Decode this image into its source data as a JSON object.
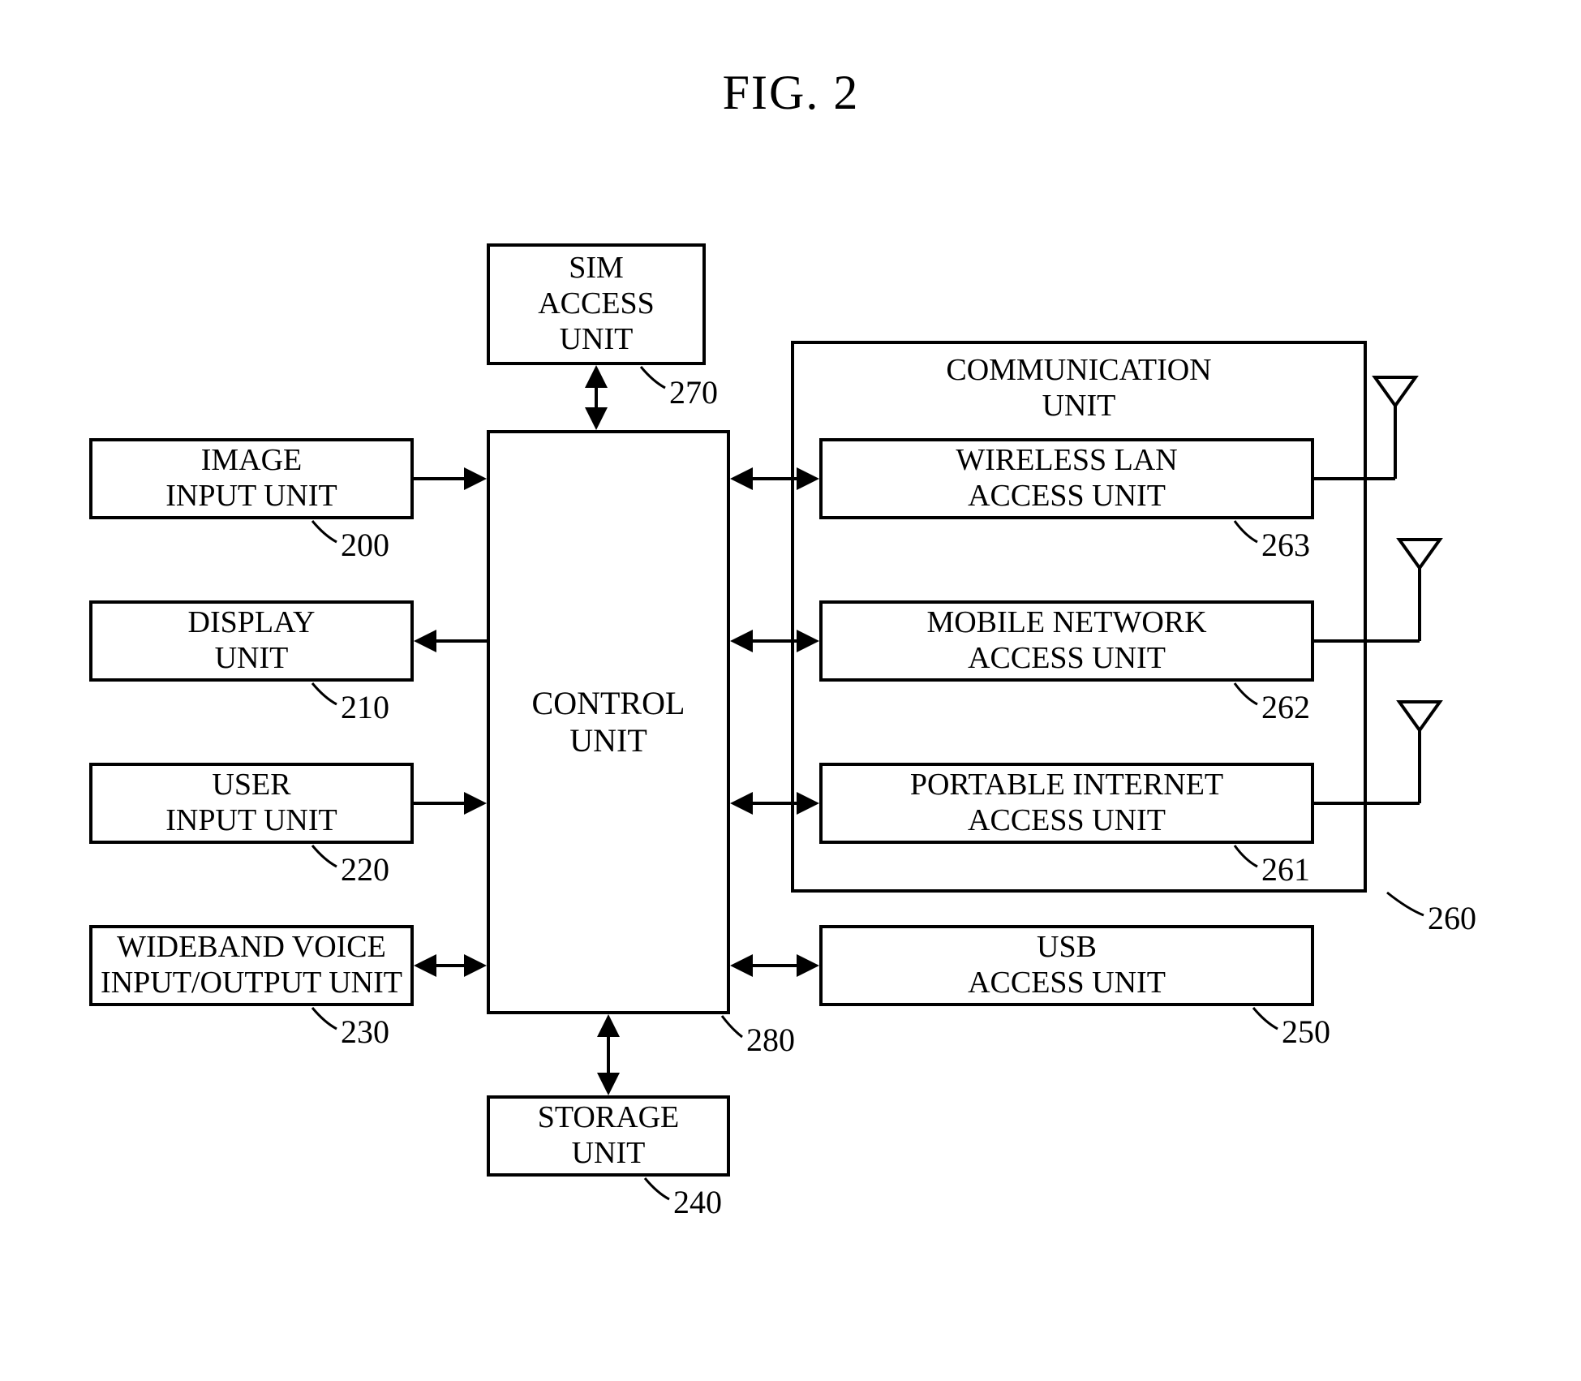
{
  "figure_title": "FIG. 2",
  "blocks": {
    "sim": {
      "label": "SIM\nACCESS\nUNIT",
      "ref": "270"
    },
    "image": {
      "label": "IMAGE\nINPUT UNIT",
      "ref": "200"
    },
    "display": {
      "label": "DISPLAY\nUNIT",
      "ref": "210"
    },
    "user": {
      "label": "USER\nINPUT UNIT",
      "ref": "220"
    },
    "voice": {
      "label": "WIDEBAND VOICE\nINPUT/OUTPUT UNIT",
      "ref": "230"
    },
    "control": {
      "label": "CONTROL\nUNIT",
      "ref": "280"
    },
    "storage": {
      "label": "STORAGE\nUNIT",
      "ref": "240"
    },
    "usb": {
      "label": "USB\nACCESS UNIT",
      "ref": "250"
    },
    "comm": {
      "label": "COMMUNICATION\nUNIT",
      "ref": "260"
    },
    "wlan": {
      "label": "WIRELESS LAN\nACCESS UNIT",
      "ref": "263"
    },
    "mobile": {
      "label": "MOBILE NETWORK\nACCESS UNIT",
      "ref": "262"
    },
    "portable": {
      "label": "PORTABLE INTERNET\nACCESS UNIT",
      "ref": "261"
    }
  },
  "connections": [
    {
      "from": "image",
      "to": "control",
      "dir": "uni",
      "towards": "control"
    },
    {
      "from": "display",
      "to": "control",
      "dir": "uni",
      "towards": "display"
    },
    {
      "from": "user",
      "to": "control",
      "dir": "uni",
      "towards": "control"
    },
    {
      "from": "voice",
      "to": "control",
      "dir": "bi"
    },
    {
      "from": "sim",
      "to": "control",
      "dir": "bi"
    },
    {
      "from": "storage",
      "to": "control",
      "dir": "bi"
    },
    {
      "from": "wlan",
      "to": "control",
      "dir": "bi"
    },
    {
      "from": "mobile",
      "to": "control",
      "dir": "bi"
    },
    {
      "from": "portable",
      "to": "control",
      "dir": "bi"
    },
    {
      "from": "usb",
      "to": "control",
      "dir": "bi"
    }
  ],
  "antennas": [
    "wlan",
    "mobile",
    "portable"
  ]
}
